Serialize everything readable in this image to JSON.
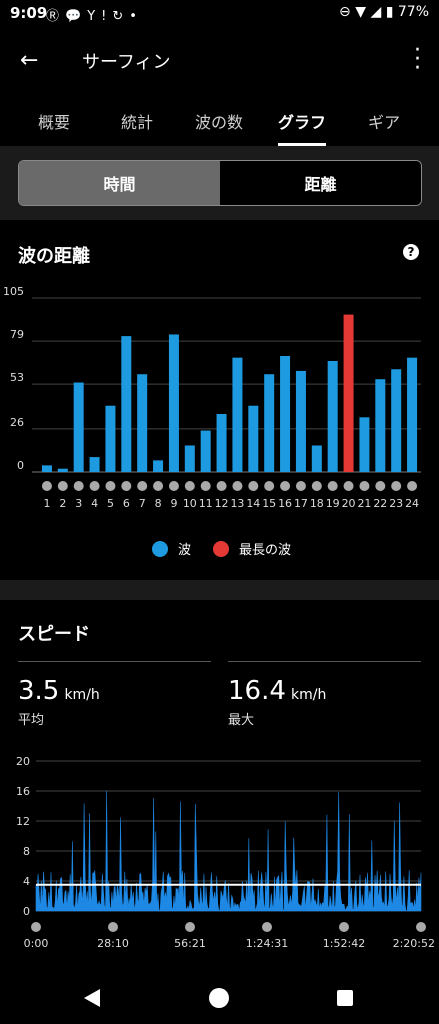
{
  "status_bar": {
    "time": "9:09",
    "left_icons": [
      "rakuten-icon",
      "chat-icon",
      "yahoo-icon",
      "sync-icon",
      "dot-icon"
    ],
    "right_icons": [
      "dnd-icon",
      "wifi-icon",
      "signal-icon",
      "battery-icon"
    ],
    "battery": "77%"
  },
  "app_bar": {
    "title": "サーフィン"
  },
  "tabs": [
    {
      "label": "概要",
      "active": false
    },
    {
      "label": "統計",
      "active": false
    },
    {
      "label": "波の数",
      "active": false
    },
    {
      "label": "グラフ",
      "active": true
    },
    {
      "label": "ギア",
      "active": false
    }
  ],
  "toggle": {
    "selected": "時間",
    "other": "距離"
  },
  "wave_distance": {
    "title": "波の距離",
    "help": "?",
    "legend": [
      {
        "label": "波",
        "color": "#1e9be0"
      },
      {
        "label": "最長の波",
        "color": "#e53935"
      }
    ]
  },
  "chart_data": [
    {
      "type": "bar",
      "title": "波の距離",
      "ylim": [
        0,
        105
      ],
      "yticks": [
        0,
        26,
        53,
        79,
        105
      ],
      "categories": [
        "1",
        "2",
        "3",
        "4",
        "5",
        "6",
        "7",
        "8",
        "9",
        "10",
        "11",
        "12",
        "13",
        "14",
        "15",
        "16",
        "17",
        "18",
        "19",
        "20",
        "21",
        "22",
        "23",
        "24"
      ],
      "values": [
        4,
        2,
        54,
        9,
        40,
        82,
        59,
        7,
        83,
        16,
        25,
        35,
        69,
        40,
        59,
        70,
        61,
        16,
        67,
        95,
        33,
        56,
        62,
        69
      ],
      "highlight_index": 19,
      "colors": {
        "bar": "#1e9be0",
        "highlight": "#e53935"
      },
      "legend": [
        "波",
        "最長の波"
      ],
      "grid": true
    },
    {
      "type": "area",
      "title": "スピード",
      "ylim": [
        0,
        20
      ],
      "yticks": [
        0,
        4,
        8,
        12,
        16,
        20
      ],
      "xticks": [
        "0:00",
        "28:10",
        "56:21",
        "1:24:31",
        "1:52:42",
        "2:20:52"
      ],
      "average_line": 3.5,
      "color": "#1e88e5",
      "grid": true
    }
  ],
  "speed": {
    "title": "スピード",
    "avg_value": "3.5",
    "avg_unit": "km/h",
    "avg_label": "平均",
    "max_value": "16.4",
    "max_unit": "km/h",
    "max_label": "最大"
  }
}
